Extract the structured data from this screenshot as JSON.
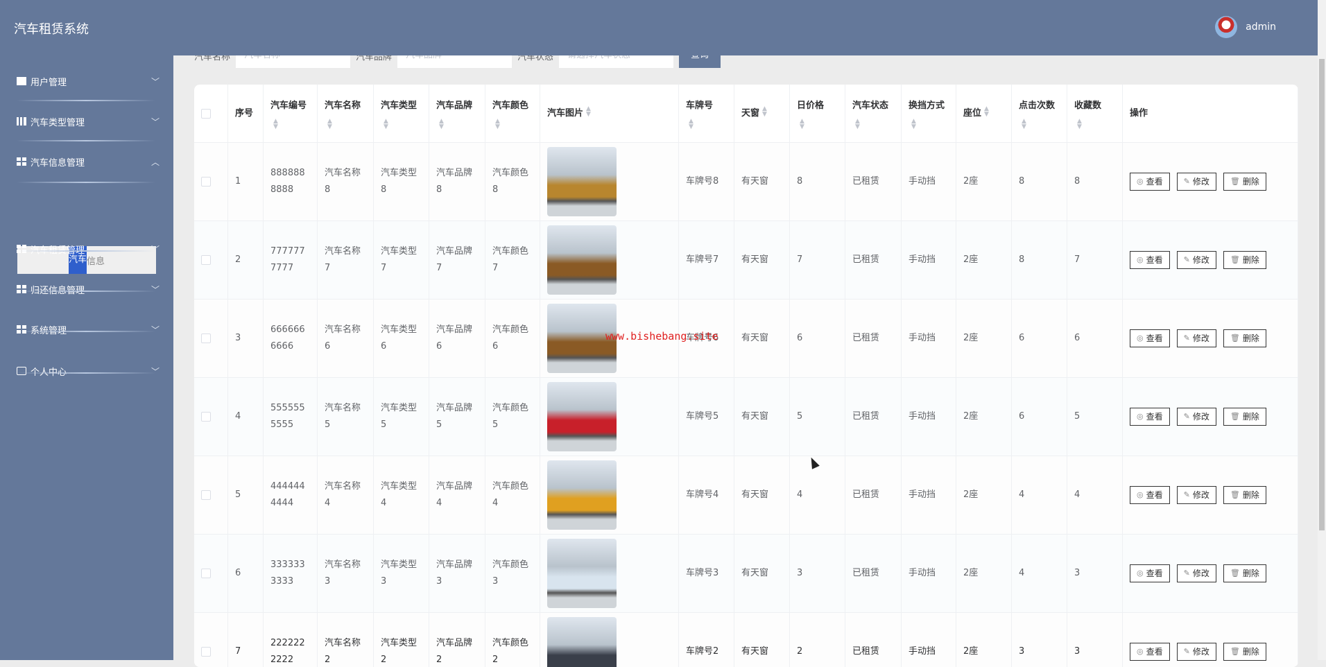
{
  "header": {
    "title": "汽车租赁系统",
    "user": "admin"
  },
  "sidebar": {
    "items": [
      {
        "label": "用户管理",
        "icon": "user-icon",
        "expanded": false
      },
      {
        "label": "汽车类型管理",
        "icon": "bar-chart-icon",
        "expanded": false
      },
      {
        "label": "汽车信息管理",
        "icon": "grid-icon",
        "expanded": true
      },
      {
        "label": "汽车租赁管理",
        "icon": "grid-icon",
        "expanded": false
      },
      {
        "label": "归还信息管理",
        "icon": "grid-icon",
        "expanded": false
      },
      {
        "label": "系统管理",
        "icon": "grid-icon",
        "expanded": false
      },
      {
        "label": "个人中心",
        "icon": "card-icon",
        "expanded": false
      }
    ],
    "sub_item": {
      "label_a": "汽车",
      "label_b": "信息"
    }
  },
  "search": {
    "name_label": "汽车名称",
    "name_placeholder": "汽车名称",
    "brand_label": "汽车品牌",
    "brand_placeholder": "汽车品牌",
    "status_label": "汽车状态",
    "status_placeholder": "请选择汽车状态",
    "query": "查询"
  },
  "table": {
    "columns": [
      "序号",
      "汽车编号",
      "汽车名称",
      "汽车类型",
      "汽车品牌",
      "汽车颜色",
      "汽车图片",
      "车牌号",
      "天窗",
      "日价格",
      "汽车状态",
      "换挡方式",
      "座位",
      "点击次数",
      "收藏数",
      "操作"
    ],
    "actions": {
      "view": "查看",
      "edit": "修改",
      "delete": "删除"
    },
    "rows": [
      [
        "1",
        "8888888888",
        "汽车名称8",
        "汽车类型8",
        "汽车品牌8",
        "汽车颜色8",
        "",
        "车牌号8",
        "有天窗",
        "8",
        "已租赁",
        "手动挡",
        "2座",
        "8",
        "8"
      ],
      [
        "2",
        "7777777777",
        "汽车名称7",
        "汽车类型7",
        "汽车品牌7",
        "汽车颜色7",
        "",
        "车牌号7",
        "有天窗",
        "7",
        "已租赁",
        "手动挡",
        "2座",
        "8",
        "7"
      ],
      [
        "3",
        "6666666666",
        "汽车名称6",
        "汽车类型6",
        "汽车品牌6",
        "汽车颜色6",
        "",
        "车牌号6",
        "有天窗",
        "6",
        "已租赁",
        "手动挡",
        "2座",
        "6",
        "6"
      ],
      [
        "4",
        "5555555555",
        "汽车名称5",
        "汽车类型5",
        "汽车品牌5",
        "汽车颜色5",
        "",
        "车牌号5",
        "有天窗",
        "5",
        "已租赁",
        "手动挡",
        "2座",
        "6",
        "5"
      ],
      [
        "5",
        "4444444444",
        "汽车名称4",
        "汽车类型4",
        "汽车品牌4",
        "汽车颜色4",
        "",
        "车牌号4",
        "有天窗",
        "4",
        "已租赁",
        "手动挡",
        "2座",
        "4",
        "4"
      ],
      [
        "6",
        "3333333333",
        "汽车名称3",
        "汽车类型3",
        "汽车品牌3",
        "汽车颜色3",
        "",
        "车牌号3",
        "有天窗",
        "3",
        "已租赁",
        "手动挡",
        "2座",
        "4",
        "3"
      ],
      [
        "7",
        "2222222222",
        "汽车名称2",
        "汽车类型2",
        "汽车品牌2",
        "汽车颜色2",
        "",
        "车牌号2",
        "有天窗",
        "2",
        "已租赁",
        "手动挡",
        "2座",
        "3",
        "3"
      ]
    ],
    "image_colors": [
      "#b8862e",
      "#8a5a25",
      "#8a5a25",
      "#c8202a",
      "#e0a020",
      "#d8e4ee",
      "#3a3f4a"
    ]
  },
  "watermark": "www.bishebang.site"
}
